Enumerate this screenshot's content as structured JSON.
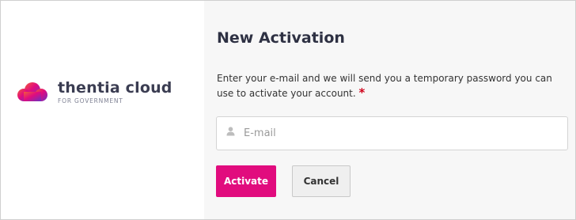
{
  "brand": {
    "name": "thentia cloud",
    "subtitle": "FOR GOVERNMENT",
    "logo_icon": "cloud-icon",
    "colors": {
      "magenta": "#e10c7e",
      "red": "#e8384f",
      "purple": "#7b2fbf"
    }
  },
  "form": {
    "title": "New Activation",
    "instructions": "Enter your e-mail and we will send you a temporary password you can  use to activate your account.",
    "required_mark": "*",
    "email": {
      "placeholder": "E-mail",
      "value": "",
      "icon": "user-icon"
    },
    "activate_label": "Activate",
    "cancel_label": "Cancel"
  },
  "colors": {
    "accent": "#e10c7e",
    "required": "#d0021b",
    "right_panel_bg": "#f7f7f7"
  }
}
